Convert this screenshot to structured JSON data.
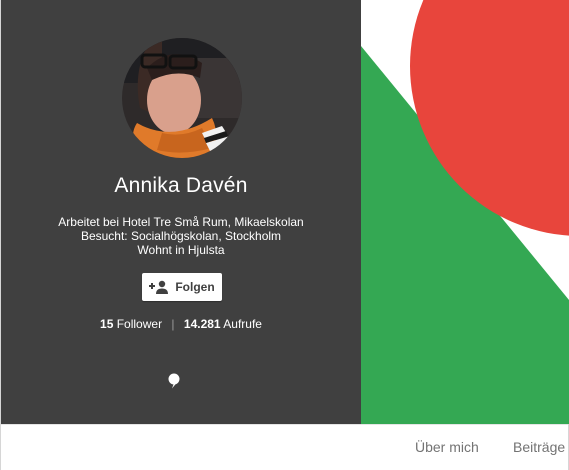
{
  "profile": {
    "name": "Annika Davén",
    "info_lines": [
      "Arbeitet bei Hotel Tre Små Rum, Mikaelskolan",
      "Besucht: Socialhögskolan, Stockholm",
      "Wohnt in Hjulsta"
    ],
    "avatar_icon": "profile-photo",
    "follow_label": "Folgen",
    "follow_icon": "add-person-icon",
    "stats": {
      "followers_count": "15",
      "followers_label": "Follower",
      "separator": "|",
      "views_count": "14.281",
      "views_label": "Aufrufe"
    },
    "comment_icon": "speech-bubble-icon"
  },
  "cover": {
    "colors": {
      "background": "#ffffff",
      "red": "#e8453c",
      "green": "#34a853",
      "card": "#404040"
    }
  },
  "tabs": [
    {
      "label": "Über mich"
    },
    {
      "label": "Beiträge"
    }
  ]
}
